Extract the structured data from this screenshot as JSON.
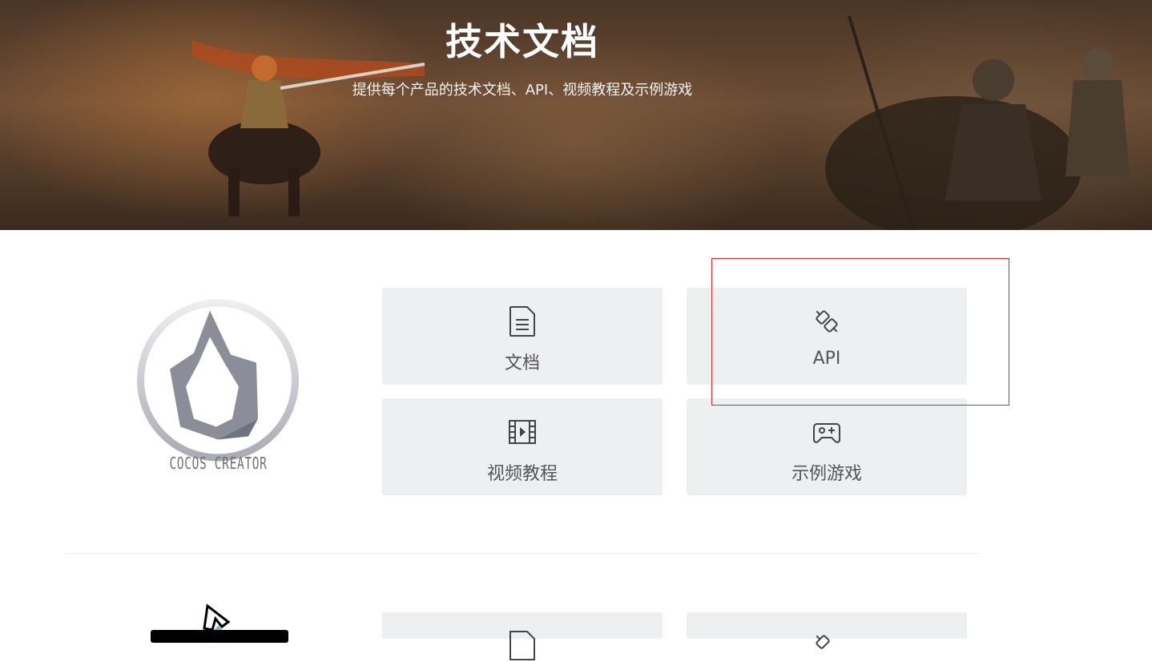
{
  "hero": {
    "title": "技术文档",
    "subtitle": "提供每个产品的技术文档、API、视频教程及示例游戏"
  },
  "product": {
    "name": "COCOS CREATOR",
    "cards": [
      {
        "label": "文档",
        "icon": "document-icon"
      },
      {
        "label": "API",
        "icon": "plug-icon"
      },
      {
        "label": "视频教程",
        "icon": "film-icon"
      },
      {
        "label": "示例游戏",
        "icon": "gamepad-icon"
      }
    ]
  },
  "colors": {
    "card_bg": "#eeeff1",
    "card_text": "#555555",
    "highlight": "#d42a2a"
  }
}
